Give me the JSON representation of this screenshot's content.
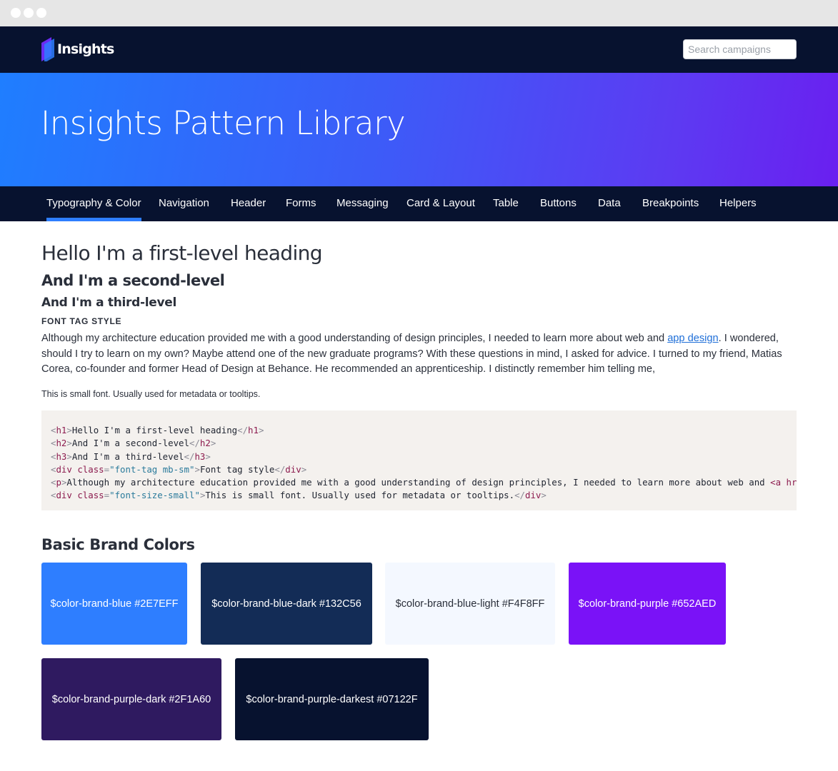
{
  "header": {
    "logo_text": "Insights",
    "search_placeholder": "Search campaigns"
  },
  "hero": {
    "title": "Insights Pattern Library"
  },
  "tabs": [
    {
      "label": "Typography & Color",
      "active": true
    },
    {
      "label": "Navigation"
    },
    {
      "label": "Header"
    },
    {
      "label": "Forms"
    },
    {
      "label": "Messaging"
    },
    {
      "label": "Card & Layout"
    },
    {
      "label": "Table"
    },
    {
      "label": "Buttons"
    },
    {
      "label": "Data"
    },
    {
      "label": "Breakpoints"
    },
    {
      "label": "Helpers"
    }
  ],
  "content": {
    "h1": "Hello I'm a first-level heading",
    "h2": "And I'm a second-level",
    "h3": "And I'm a third-level",
    "font_tag": "Font tag style",
    "paragraph_before_link": "Although my architecture education provided me with a good understanding of design principles, I needed to learn more about web and ",
    "paragraph_link": "app design",
    "paragraph_after_link": ". I wondered, should I try to learn on my own? Maybe attend one of the new graduate programs? With these questions in mind, I asked for advice. I turned to my friend, Matias Corea, co-founder and former Head of Design at Behance. He recommended an apprenticeship. I distinctly remember him telling me,",
    "small_text": "This is small font. Usually used for metadata or tooltips."
  },
  "code": {
    "lines": [
      {
        "open_tag": "h1",
        "text": "Hello I'm a first-level heading",
        "close_tag": "h1"
      },
      {
        "open_tag": "h2",
        "text": "And I'm a second-level",
        "close_tag": "h2"
      },
      {
        "open_tag": "h3",
        "text": "And I'm a third-level",
        "close_tag": "h3"
      },
      {
        "open_tag": "div",
        "attr": "class",
        "attr_value": "\"font-tag mb-sm\"",
        "text": "Font tag style",
        "close_tag": "div"
      },
      {
        "open_tag": "p",
        "text": "Although my architecture education provided me with a good understanding of design principles, I needed to learn more about web and ",
        "tail": "<a hr"
      },
      {
        "open_tag": "div",
        "attr": "class",
        "attr_value": "\"font-size-small\"",
        "text": "This is small font. Usually used for metadata or tooltips.",
        "close_tag": "div"
      }
    ]
  },
  "colors": {
    "heading": "Basic Brand Colors",
    "swatches": [
      {
        "label": "$color-brand-blue #2E7EFF",
        "hex": "#2E7EFF",
        "text_color": "#FFFFFF"
      },
      {
        "label": "$color-brand-blue-dark #132C56",
        "hex": "#132C56",
        "text_color": "#FFFFFF"
      },
      {
        "label": "$color-brand-blue-light #F4F8FF",
        "hex": "#F4F8FF",
        "text_color": "#2A2F3A"
      },
      {
        "label": "$color-brand-purple #652AED",
        "hex": "#7A12F7",
        "text_color": "#FFFFFF"
      },
      {
        "label": "$color-brand-purple-dark #2F1A60",
        "hex": "#2F1A60",
        "text_color": "#FFFFFF"
      },
      {
        "label": "$color-brand-purple-darkest #07122F",
        "hex": "#07122F",
        "text_color": "#FFFFFF"
      }
    ]
  }
}
